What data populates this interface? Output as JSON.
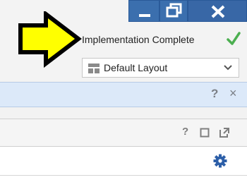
{
  "window": {
    "minimize_icon": "minimize-icon",
    "restore_icon": "restore-icon",
    "close_icon": "close-icon",
    "button_color": "#3b6fae"
  },
  "status": {
    "text": "Implementation Complete",
    "icon": "checkmark-icon",
    "icon_color": "#4caf50"
  },
  "layout_select": {
    "selected": "Default Layout",
    "icon": "layout-grid-icon",
    "chevron_icon": "chevron-down-icon"
  },
  "band": {
    "help_label": "?",
    "close_label": "×"
  },
  "panel": {
    "help_label": "?",
    "settings_icon": "gear-icon",
    "settings_color": "#2d5fa8"
  },
  "annotation": {
    "arrow_color": "#ffff00"
  }
}
